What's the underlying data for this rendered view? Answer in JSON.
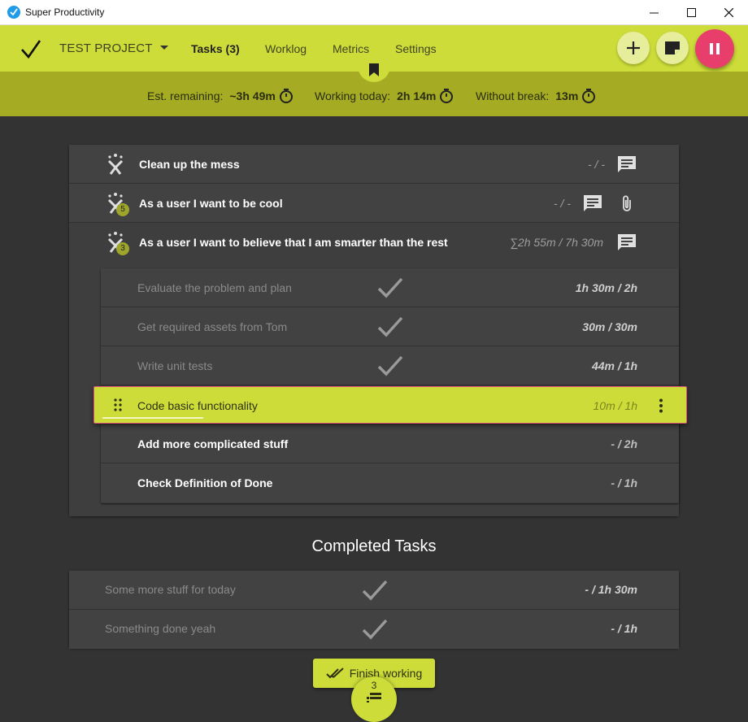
{
  "window": {
    "title": "Super Productivity",
    "controls": [
      "minimize",
      "maximize",
      "close"
    ]
  },
  "header": {
    "project_name": "TEST PROJECT",
    "nav": [
      {
        "label": "Tasks (3)",
        "active": true
      },
      {
        "label": "Worklog",
        "active": false
      },
      {
        "label": "Metrics",
        "active": false
      },
      {
        "label": "Settings",
        "active": false
      }
    ],
    "actions": [
      "add-icon",
      "note-icon",
      "pause-icon"
    ]
  },
  "stats": {
    "remaining_label": "Est. remaining:",
    "remaining_value": "~3h 49m",
    "today_label": "Working today:",
    "today_value": "2h 14m",
    "break_label": "Without break:",
    "break_value": "13m"
  },
  "tasks": [
    {
      "title": "Clean up the mess",
      "time": "- / -",
      "badge": ""
    },
    {
      "title": "As a user I want to be cool",
      "time": "- / -",
      "badge": "5"
    },
    {
      "title": "As a user I want to believe that I am smarter than the rest",
      "time": "∑2h 55m / 7h 30m",
      "badge": "3"
    }
  ],
  "subtasks": [
    {
      "title": "Evaluate the problem and plan",
      "time": "1h 30m / 2h",
      "done": true
    },
    {
      "title": "Get required assets from Tom",
      "time": "30m / 30m",
      "done": true
    },
    {
      "title": "Write unit tests",
      "time": "44m / 1h",
      "done": true
    },
    {
      "title": "Code basic functionality",
      "time": "10m / 1h",
      "done": false,
      "current": true,
      "progress": 0.17
    },
    {
      "title": "Add more complicated stuff",
      "time": "- / 2h",
      "done": false
    },
    {
      "title": "Check Definition of Done",
      "time": "- / 1h",
      "done": false
    }
  ],
  "completed": {
    "heading": "Completed Tasks",
    "items": [
      {
        "title": "Some more stuff for today",
        "time": "- / 1h 30m"
      },
      {
        "title": "Something done yeah",
        "time": "- / 1h"
      }
    ]
  },
  "finish_label": "Finish working",
  "backlog_count": "3",
  "colors": {
    "accent": "#cddc39",
    "accent_dark": "#a5ab23",
    "pause": "#e83e6c",
    "background": "#333333"
  }
}
